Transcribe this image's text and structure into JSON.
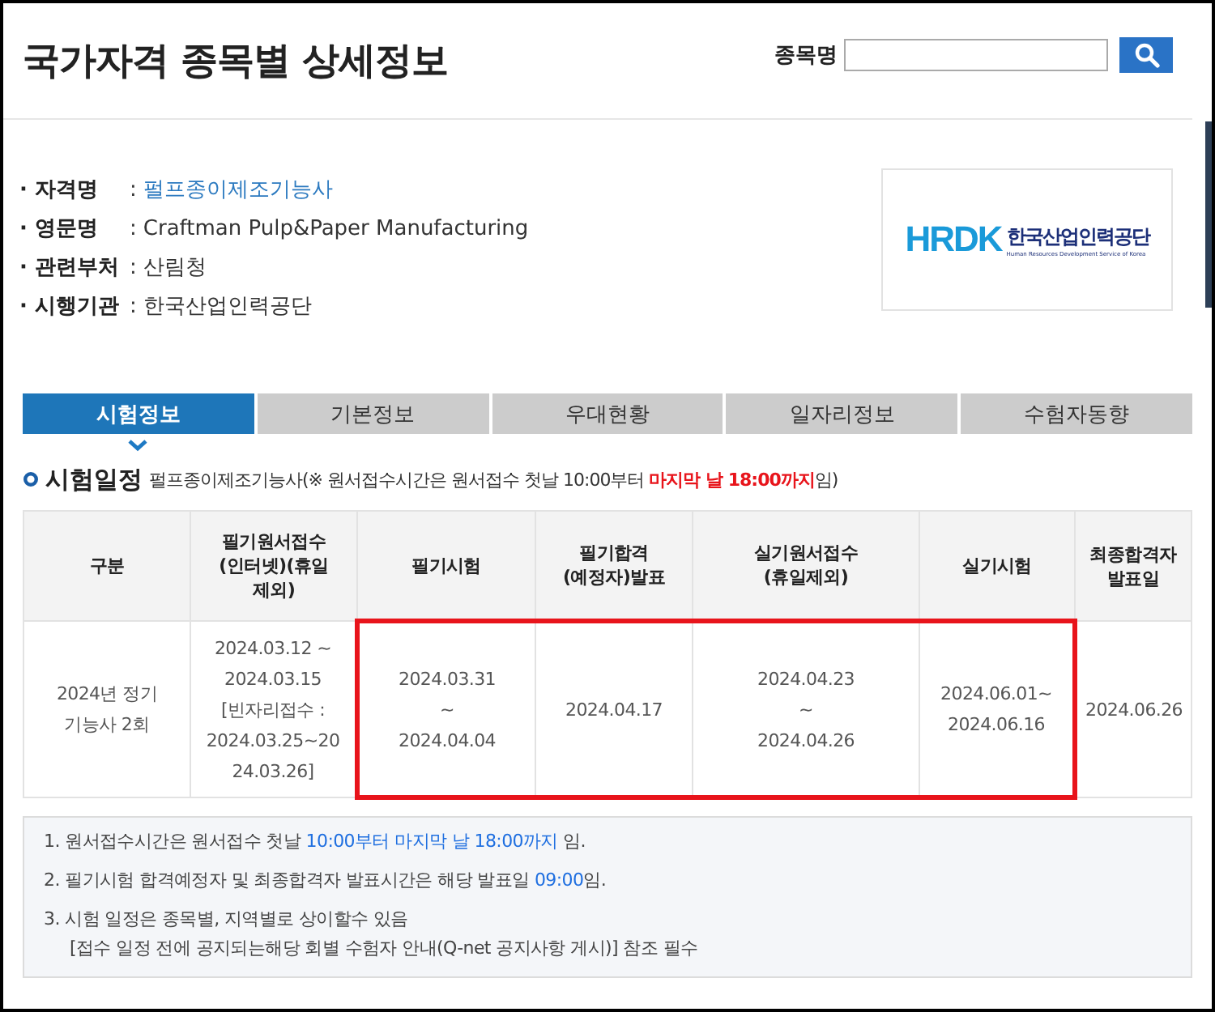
{
  "page_title": "국가자격 종목별 상세정보",
  "search": {
    "label": "종목명"
  },
  "info": [
    {
      "label": "· 자격명",
      "sep": ":",
      "value": "펄프종이제조기능사",
      "kind": "link"
    },
    {
      "label": "· 영문명",
      "sep": ":",
      "value": "Craftman Pulp&Paper Manufacturing",
      "kind": "text"
    },
    {
      "label": "· 관련부처",
      "sep": ":",
      "value": "산림청",
      "kind": "text"
    },
    {
      "label": "· 시행기관",
      "sep": ":",
      "value": "한국산업인력공단",
      "kind": "text"
    }
  ],
  "logo": {
    "mark": "HRDK",
    "name": "한국산업인력공단",
    "subtitle": "Human Resources Development Service of Korea"
  },
  "tabs": [
    {
      "label": "시험정보",
      "selected": true
    },
    {
      "label": "기본정보",
      "selected": false
    },
    {
      "label": "우대현황",
      "selected": false
    },
    {
      "label": "일자리정보",
      "selected": false
    },
    {
      "label": "수험자동향",
      "selected": false
    }
  ],
  "section": {
    "title": "시험일정",
    "note": [
      {
        "text": "펄프종이제조기능사(※ 원서접수시간은 원서접수 첫날 10:00부터 ",
        "accent": false
      },
      {
        "text": "마지막 날 18:00까지",
        "accent": true
      },
      {
        "text": "임)",
        "accent": false
      }
    ]
  },
  "table": {
    "columns": [
      "구분",
      "필기원서접수\n(인터넷)(휴일\n제외)",
      "필기시험",
      "필기합격\n(예정자)발표",
      "실기원서접수\n(휴일제외)",
      "실기시험",
      "최종합격자\n발표일"
    ],
    "rows": [
      [
        {
          "text": "2024년 정기\n기능사 2회",
          "highlighted": false
        },
        {
          "text": "2024.03.12 ~\n2024.03.15\n[빈자리접수 :\n2024.03.25~20\n24.03.26]",
          "highlighted": false
        },
        {
          "text": "2024.03.31\n~\n2024.04.04",
          "highlighted": true
        },
        {
          "text": "2024.04.17",
          "highlighted": true
        },
        {
          "text": "2024.04.23\n~\n2024.04.26",
          "highlighted": true
        },
        {
          "text": "2024.06.01~\n2024.06.16",
          "highlighted": true
        },
        {
          "text": "2024.06.26",
          "highlighted": false
        }
      ]
    ]
  },
  "notes": [
    {
      "lines": [
        [
          {
            "text": "1. 원서접수시간은 원서접수 첫날 ",
            "accent": false
          },
          {
            "text": "10:00부터 마지막 날 18:00까지",
            "accent": true
          },
          {
            "text": " 임.",
            "accent": false
          }
        ]
      ]
    },
    {
      "lines": [
        [
          {
            "text": "2. 필기시험 합격예정자 및 최종합격자 발표시간은 해당 발표일 ",
            "accent": false
          },
          {
            "text": "09:00",
            "accent": true
          },
          {
            "text": "임.",
            "accent": false
          }
        ]
      ]
    },
    {
      "lines": [
        [
          {
            "text": "3. 시험 일정은 종목별, 지역별로 상이할수 있음",
            "accent": false
          }
        ],
        [
          {
            "text": "[접수 일정 전에 공지되는해당 회별 수험자 안내(Q-net 공지사항 게시)] 참조 필수",
            "accent": false
          }
        ]
      ]
    }
  ]
}
